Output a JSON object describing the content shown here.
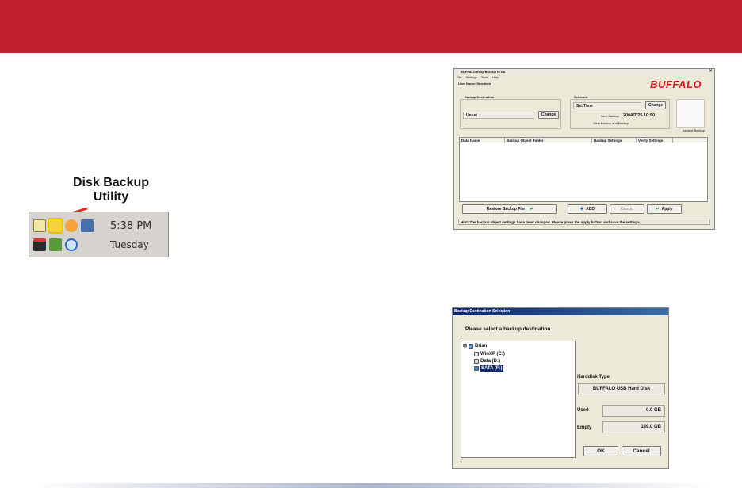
{
  "callout": {
    "line1": "Disk Backup",
    "line2": "Utility"
  },
  "tray": {
    "time": "5:38 PM",
    "day": "Tuesday"
  },
  "backup_window": {
    "title": "BUFFALO Easy Backup to G8",
    "menu": [
      "File",
      "Settings",
      "Tools",
      "Help"
    ],
    "user": "User Name: Strudentr",
    "logo": "BUFFALO",
    "destination": {
      "label": "Backup Destination",
      "value": "Unset",
      "change": "Change",
      "sub": "--"
    },
    "schedule": {
      "label": "Schedule",
      "value": "Set Time",
      "change": "Change",
      "next_label": "Next Backup",
      "next_value": "2004/7/25 10:50",
      "note": "View Backup and Backup"
    },
    "drive_caption": "Intranet Backup",
    "columns": [
      "Data Name",
      "Backup Object Folder",
      "Backup Settings",
      "Verify Settings"
    ],
    "buttons": {
      "restore": "Restore Backup File",
      "add": "ADD",
      "cancel": "Cancel",
      "apply": "Apply"
    },
    "status": "Hint: The backup object settings have been changed. Please press the apply button and save the settings."
  },
  "dest_window": {
    "title": "Backup Destination Selection",
    "prompt": "Please select a backup destination",
    "tree": {
      "root": "Brian",
      "items": [
        "WinXP (C:)",
        "Data (D:)",
        "SATA (F:)"
      ],
      "selected_index": 2
    },
    "harddisk_type_label": "Harddisk Type",
    "harddisk_type_value": "BUFFALO USB Hard Disk",
    "used_label": "Used",
    "used_value": "0.0 GB",
    "empty_label": "Empty",
    "empty_value": "149.0 GB",
    "ok": "OK",
    "cancel": "Cancel"
  },
  "colors": {
    "band": "#c0202c",
    "logo": "#d7141c",
    "titlebar": "#0a246a"
  }
}
